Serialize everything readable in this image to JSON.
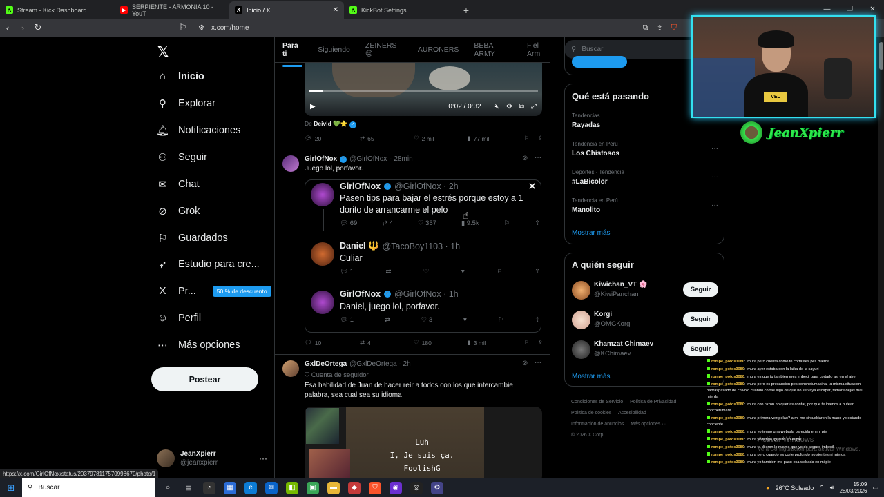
{
  "browser": {
    "tabs": [
      {
        "title": "Stream - Kick Dashboard",
        "icon": "K",
        "color": "#53fc18"
      },
      {
        "title": "SERPIENTE - ARMONIA 10 - YouT",
        "icon": "▶",
        "color": "#ff0000"
      },
      {
        "title": "Inicio / X",
        "icon": "X",
        "color": "#000000"
      },
      {
        "title": "KickBot Settings",
        "icon": "K",
        "color": "#53fc18"
      }
    ],
    "url": "x.com/home",
    "status_url": "https://x.com/GirlOfNox/status/2037978117570998670/photo/1"
  },
  "nav": {
    "items": [
      {
        "label": "Inicio",
        "icon": "home-icon",
        "glyph": "⌂"
      },
      {
        "label": "Explorar",
        "icon": "search-icon",
        "glyph": "⚲"
      },
      {
        "label": "Notificaciones",
        "icon": "bell-icon",
        "glyph": "🔔︎"
      },
      {
        "label": "Seguir",
        "icon": "person-add-icon",
        "glyph": "⚇"
      },
      {
        "label": "Chat",
        "icon": "mail-icon",
        "glyph": "✉"
      },
      {
        "label": "Grok",
        "icon": "grok-icon",
        "glyph": "⊘"
      },
      {
        "label": "Guardados",
        "icon": "bookmark-icon",
        "glyph": "⚐"
      },
      {
        "label": "Estudio para cre...",
        "icon": "rocket-icon",
        "glyph": "➶"
      },
      {
        "label": "Pr...",
        "icon": "x-logo-icon",
        "glyph": "X"
      },
      {
        "label": "Perfil",
        "icon": "profile-icon",
        "glyph": "☺"
      },
      {
        "label": "Más opciones",
        "icon": "more-circle-icon",
        "glyph": "⋯"
      }
    ],
    "promo": "50 % de descuento",
    "post_button": "Postear",
    "account": {
      "name": "JeanXpierr",
      "handle": "@jeanxpierr"
    }
  },
  "feed": {
    "tabs": [
      "Para ti",
      "Siguiendo",
      "ZEINERS 😝",
      "AURONERS",
      "BEBA ARMY",
      "Fiel Arm"
    ],
    "video": {
      "time": "0:02 / 0:32",
      "progress": 0.0625
    },
    "video_post": {
      "from_prefix": "De",
      "from_name": "Deivid 💚⭐",
      "replies": "20",
      "reposts": "65",
      "likes": "2 mil",
      "views": "77 mil"
    },
    "post1": {
      "name": "GirlOfNox",
      "handle": "@GirlOfNox",
      "time": "· 28min",
      "text": "Juego lol, porfavor.",
      "replies": "10",
      "reposts": "4",
      "likes": "180",
      "views": "3 mil",
      "thread": [
        {
          "name": "GirlOfNox",
          "handle": "@GirlOfNox · 2h",
          "text": "Pasen tips para bajar el estrés porque estoy a 1 dorito de arrancarme el pelo",
          "replies": "69",
          "reposts": "4",
          "likes": "357",
          "views": "9.5k"
        },
        {
          "name": "Daniel 🔱",
          "handle": "@TacoBoy1103 · 1h",
          "text": "Culiar",
          "replies": "1",
          "reposts": "",
          "likes": "",
          "views": ""
        },
        {
          "name": "GirlOfNox",
          "handle": "@GirlOfNox · 1h",
          "text": "Daniel, juego lol, porfavor.",
          "replies": "1",
          "reposts": "",
          "likes": "3",
          "views": ""
        }
      ]
    },
    "post2": {
      "name": "GxlDeOrtega",
      "handle": "@GxlDeOrtega · 2h",
      "subscriber": "Cuenta de seguidor",
      "text": "Esa habilidad de Juan de hacer reír a todos con los que intercambie palabra, sea cual sea su idioma",
      "media_lines": [
        "Luh",
        "I, Je suis ça.",
        "FoolishG"
      ]
    }
  },
  "right": {
    "search_placeholder": "Buscar",
    "trending_title": "Qué está pasando",
    "trends": [
      {
        "cat": "Tendencias",
        "name": "Rayadas"
      },
      {
        "cat": "Tendencia en Perú",
        "name": "Los Chistosos"
      },
      {
        "cat": "Deportes · Tendencia",
        "name": "#LaBicolor"
      },
      {
        "cat": "Tendencia en Perú",
        "name": "Manolito"
      }
    ],
    "show_more": "Mostrar más",
    "who_title": "A quién seguir",
    "follow": [
      {
        "name": "Kiwichan_VT 🌸",
        "handle": "@KiwiPanchan",
        "button": "Seguir"
      },
      {
        "name": "Korgi",
        "handle": "@OMGKorgi",
        "button": "Seguir"
      },
      {
        "name": "Khamzat Chimaev",
        "handle": "@KChimaev",
        "button": "Seguir"
      }
    ],
    "footer": [
      "Condiciones de Servicio",
      "Política de Privacidad",
      "Política de cookies",
      "Accesibilidad",
      "Información de anuncios",
      "Más opciones ···",
      "© 2026 X Corp."
    ]
  },
  "overlay": {
    "brand": "JeanXpierr",
    "cam_shirt": "VEL",
    "chat": [
      {
        "user": "rompe_potos3080",
        "text": ": lmura pero cuenta como te cortastes pes mierda"
      },
      {
        "user": "rompe_potos3080",
        "text": ": lmura ayer estaba con la laika de la sayuri"
      },
      {
        "user": "rompe_potos3080",
        "text": ": lmura es que tu tambien eres imbecil para cortarlo asi en el aire"
      },
      {
        "user": "rompe_potos3080",
        "text": ": lmura pero es precaucion pes conchetumakina, la misma situacion habraspasado de chivolo cuando cortas algo de que no se vaya escapar, tamare dejas mal mierda"
      },
      {
        "user": "rompe_potos3080",
        "text": ": lmura con razon no querías contar, por que te ibamos a putear conchetumare"
      },
      {
        "user": "rompe_potos3080",
        "text": ": lmura primera vez pelao? a mi me circuskiaron la mano yo estando conciente"
      },
      {
        "user": "rompe_potos3080",
        "text": ": lmura yo tengo una webada parecida en mi pie"
      },
      {
        "user": "rompe_potos3080",
        "text": ": lmura yo tengo igualito en el pie"
      },
      {
        "user": "rompe_potos3080",
        "text": ": lmura te dijeron lo mismo que yo de seguro imbecil"
      },
      {
        "user": "rompe_potos3080",
        "text": ": lmura pero cuando es corte profundo no sientes ni mierda"
      },
      {
        "user": "rompe_potos3080",
        "text": ": lmura yo tambien me paso esa webada en mi pie"
      }
    ],
    "watermark_1": "Activar Windows",
    "watermark_2": "Ve a Configuración para activar Windows."
  },
  "taskbar": {
    "search": "Buscar",
    "weather": "26°C  Soleado",
    "time": "15:09",
    "date": "28/03/2026"
  },
  "colors": {
    "accent": "#1d9bf0",
    "kick": "#53fc18",
    "cam_border": "#33e0f0"
  }
}
